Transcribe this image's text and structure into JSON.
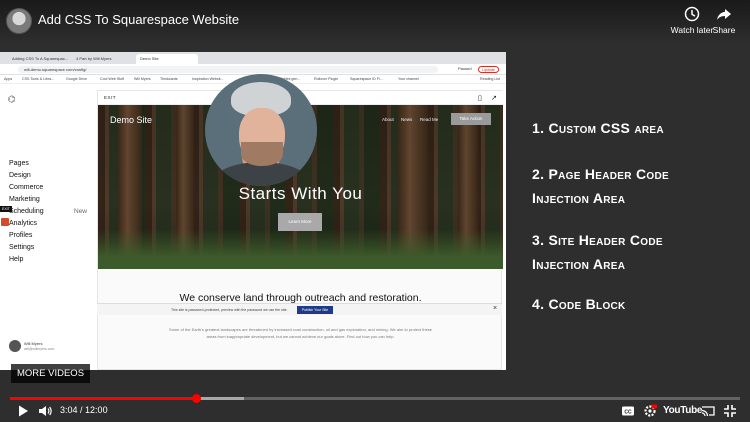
{
  "player": {
    "title": "Add CSS To Squarespace Website",
    "watch_later": "Watch later",
    "share": "Share",
    "more_videos": "MORE VIDEOS",
    "time_current": "3:04",
    "time_separator": " / ",
    "time_total": "12:00",
    "progress_fraction": 0.255,
    "buffered_fraction": 0.32,
    "youtube_label": "YouTube",
    "accent_color": "#ff0000"
  },
  "browser": {
    "tabs": [
      "Adding CSS To A Squarespac...",
      "4 Part by Will Myers",
      "Demo Site"
    ],
    "url": "will-demo.squarespace.com/config/",
    "paused": "Paused",
    "update": "Update",
    "bookmarks": [
      "Apps",
      "CSS Tools & Libra...",
      "Google Drive",
      "Cool Web Stuff",
      "Will Myers",
      "Thinkcards",
      "Inspiration Websit...",
      "Tables gen...",
      "Rollover Plugin",
      "Squarespace ID Fi...",
      "Your channel"
    ],
    "reading_list": "Reading List"
  },
  "squarespace": {
    "nav": [
      "Pages",
      "Design",
      "Commerce",
      "Marketing",
      "Scheduling",
      "Analytics",
      "Profiles",
      "Settings",
      "Help"
    ],
    "new_label": "New",
    "edit_tag": "EXIT",
    "user_name": "Will Myers",
    "user_email": "will@willmyers.com"
  },
  "preview": {
    "edit_label": "EXIT",
    "site_name": "Demo Site",
    "nav": [
      "About",
      "News",
      "Read Me"
    ],
    "take_action": "Take Action",
    "hero_heading": "Starts With You",
    "learn_more": "Learn More",
    "content_heading": "We conserve land through outreach and restoration.",
    "content_body": "Some of the Earth's greatest landscapes are threatened by increased road construction, oil and gas exploration, and mining. We aim to protect these areas from inappropriate development, but we cannot achieve our goals alone. Find out how you can help.",
    "banner_text": "This site is password-protected, preview with the password we use the site.",
    "publish_label": "Publish Your Site"
  },
  "checklist": [
    "1. Custom CSS area",
    "2. Page Header Code Injection Area",
    "3. Site Header Code Injection Area",
    "4. Code Block"
  ]
}
